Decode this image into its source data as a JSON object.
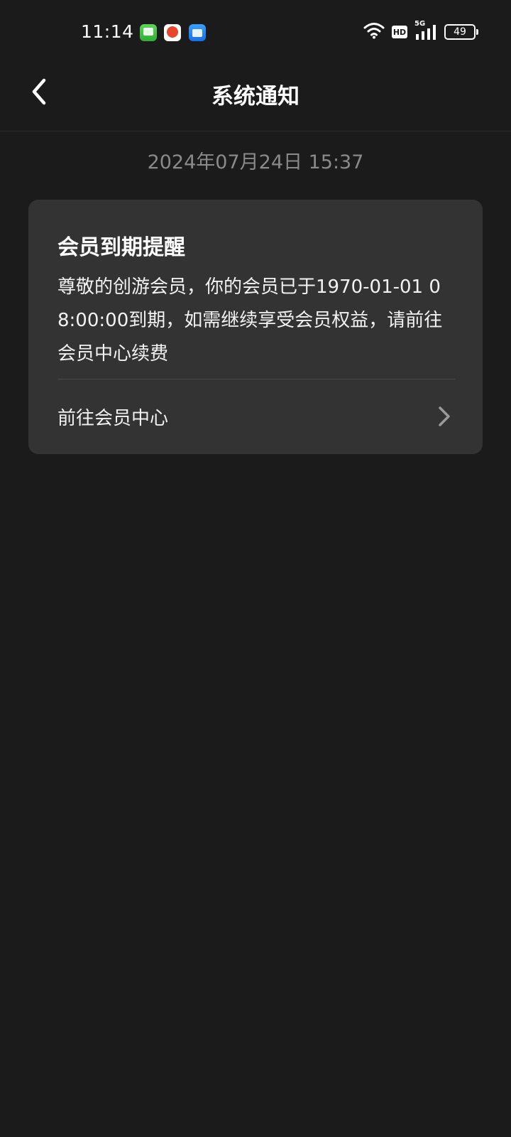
{
  "status_bar": {
    "time": "11:14",
    "battery": "49",
    "hd_label": "HD",
    "network": "5G",
    "notification_icons": [
      "messages-icon",
      "app-icon",
      "files-icon"
    ]
  },
  "header": {
    "title": "系统通知"
  },
  "notification": {
    "timestamp": "2024年07月24日 15:37",
    "title": "会员到期提醒",
    "body": "尊敬的创游会员，你的会员已于1970-01-01 08:00:00到期，如需继续享受会员权益，请前往会员中心续费",
    "link_label": "前往会员中心"
  },
  "colors": {
    "background": "#1b1b1b",
    "card": "#333333",
    "timestamp": "#8a8a8a",
    "text": "#ffffff"
  }
}
